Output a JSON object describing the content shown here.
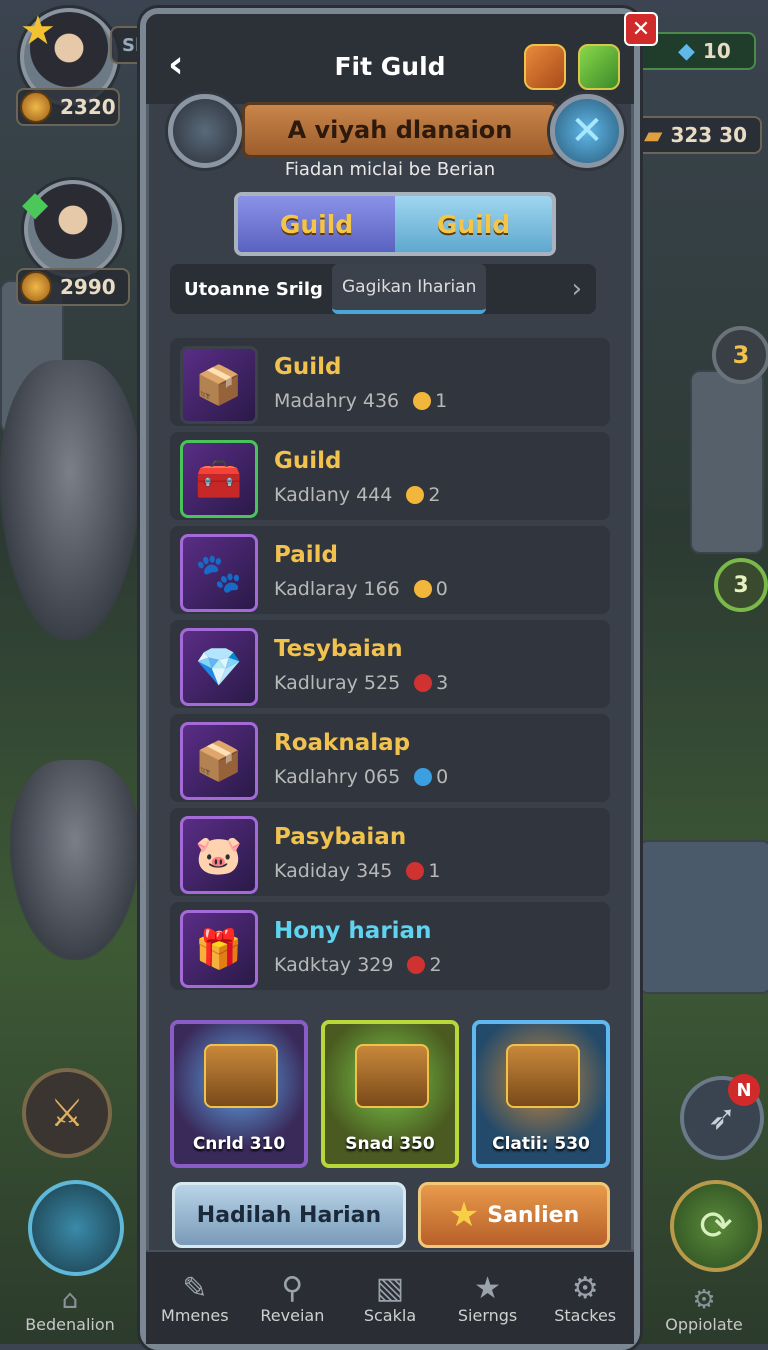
{
  "left_hud": [
    {
      "value": "2320"
    },
    {
      "value": "2990"
    }
  ],
  "right_hud": {
    "gems": "10",
    "gold": "323 30",
    "badge_top": "3",
    "badge_mid": "3",
    "notif": "N"
  },
  "left_top_label": "Sl",
  "panel": {
    "title": "Fit Guld",
    "back_icon": "‹",
    "banner": "A viyah dlanaion",
    "subtitle": "Fiadan miclai be Berian",
    "tabs": [
      {
        "label": "Guild"
      },
      {
        "label": "Guild"
      }
    ],
    "filter_label": "Utoanne Srilg",
    "filter_chip": "Gagikan Iharian",
    "filter_arrow": "›"
  },
  "items": [
    {
      "name": "Guild",
      "meta": "Madahry 436",
      "count": "1",
      "dot_color": "#f2b63a",
      "icon": "📦",
      "border": "#3b424b",
      "name_color": "#f1c24e"
    },
    {
      "name": "Guild",
      "meta": "Kadlany 444",
      "count": "2",
      "dot_color": "#f2b63a",
      "icon": "🧰",
      "border": "#49c45a",
      "name_color": "#f1c24e"
    },
    {
      "name": "Paild",
      "meta": "Kadlaray 166",
      "count": "0",
      "dot_color": "#f2b63a",
      "icon": "🐾",
      "border": "#a46bd8",
      "name_color": "#f1c24e"
    },
    {
      "name": "Tesybaian",
      "meta": "Kadluray 525",
      "count": "3",
      "dot_color": "#d03232",
      "icon": "💎",
      "border": "#a46bd8",
      "name_color": "#f1c24e"
    },
    {
      "name": "Roaknalap",
      "meta": "Kadlahry 065",
      "count": "0",
      "dot_color": "#3aa0e0",
      "icon": "📦",
      "border": "#a46bd8",
      "name_color": "#f1c24e"
    },
    {
      "name": "Pasybaian",
      "meta": "Kadiday 345",
      "count": "1",
      "dot_color": "#d03232",
      "icon": "🐷",
      "border": "#a46bd8",
      "name_color": "#f1c24e"
    },
    {
      "name": "Hony harian",
      "meta": "Kadktay 329",
      "count": "2",
      "dot_color": "#d03232",
      "icon": "🎁",
      "border": "#a46bd8",
      "name_color": "#5fd3f0"
    }
  ],
  "chests": [
    {
      "label": "Cnrld 310",
      "bg": "#3a2a5a",
      "border": "#8a5cc8",
      "glow": "#5fa8e8"
    },
    {
      "label": "Snad 350",
      "bg": "#4a5a20",
      "border": "#b8d83a",
      "glow": "#7ac84a"
    },
    {
      "label": "Clatii: 530",
      "bg": "#234a6a",
      "border": "#5fb8f0",
      "glow": "#c8883a"
    }
  ],
  "buttons": {
    "left": "Hadilah Harian",
    "right": "Sanlien"
  },
  "nav": [
    {
      "label": "Mmenes",
      "icon": "✎"
    },
    {
      "label": "Reveian",
      "icon": "⚲"
    },
    {
      "label": "Scakla",
      "icon": "▧"
    },
    {
      "label": "Sierngs",
      "icon": "★"
    },
    {
      "label": "Stackes",
      "icon": "⚙"
    }
  ],
  "outer_nav": {
    "left": "Bedenalion",
    "right": "Oppiolate"
  }
}
